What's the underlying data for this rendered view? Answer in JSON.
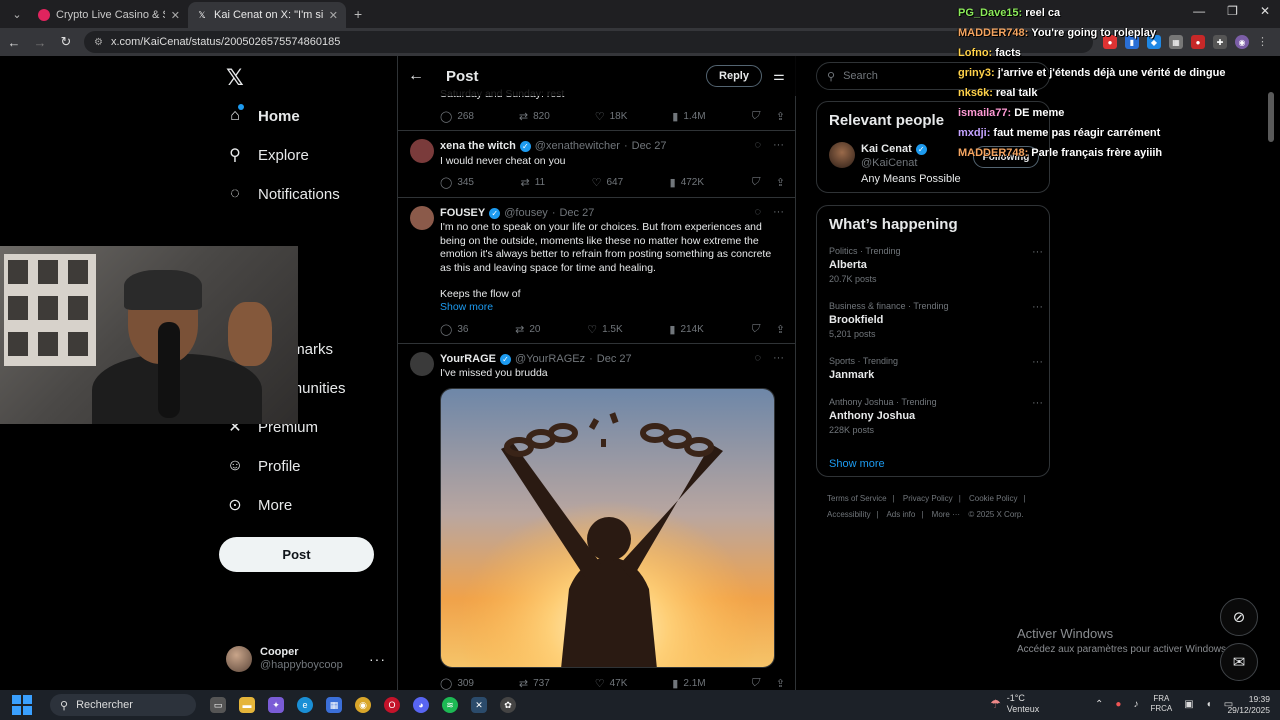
{
  "browser": {
    "tabs": [
      {
        "title": "Crypto Live Casino & Slots | Jo",
        "active": false,
        "icon_color": "#e0245e"
      },
      {
        "title": "Kai Cenat on X: \"I'm single I wil",
        "active": true,
        "icon_color": "#ffffff"
      }
    ],
    "new_tab_glyph": "+",
    "url": "x.com/KaiCenat/status/2005026575574860185"
  },
  "nav": {
    "logo": "𝕏",
    "items": [
      {
        "label": "Home",
        "icon": "home-icon",
        "glyph": "⌂"
      },
      {
        "label": "Explore",
        "icon": "search-icon",
        "glyph": "⚲"
      },
      {
        "label": "Notifications",
        "icon": "bell-icon",
        "glyph": "🔔"
      },
      {
        "label": "Bookmarks",
        "icon": "bookmark-icon",
        "glyph": "⛉"
      },
      {
        "label": "Communities",
        "icon": "communities-icon",
        "glyph": "⚇"
      },
      {
        "label": "Premium",
        "icon": "x-icon",
        "glyph": "✕"
      },
      {
        "label": "Profile",
        "icon": "profile-icon",
        "glyph": "☺"
      },
      {
        "label": "More",
        "icon": "more-circle-icon",
        "glyph": "⊙"
      }
    ],
    "visible_partial": {
      "notifications": "ications",
      "bookmarks": "marks"
    },
    "post_button": "Post",
    "account": {
      "name": "Cooper",
      "handle": "@happyboycoop"
    }
  },
  "post_header": {
    "title": "Post",
    "reply_button": "Reply"
  },
  "tweets": [
    {
      "text": "Saturday and Sunday: rest",
      "replies": "268",
      "reposts": "820",
      "likes": "18K",
      "views": "1.4M"
    },
    {
      "name": "xena the witch",
      "handle": "@xenathewitcher",
      "date": "Dec 27",
      "text": "I would never cheat on you",
      "replies": "345",
      "reposts": "11",
      "likes": "647",
      "views": "472K",
      "avatar_color": "#7a3b3b"
    },
    {
      "name": "FOUSEY",
      "handle": "@fousey",
      "date": "Dec 27",
      "text": "I'm no one to speak on your life or choices. But from experiences and being on the outside, moments like these no matter how extreme the emotion it's always better to refrain from posting something as concrete as this and leaving space for time and healing.",
      "text2": "Keeps the flow of",
      "show_more": "Show more",
      "replies": "36",
      "reposts": "20",
      "likes": "1.5K",
      "views": "214K",
      "avatar_color": "#8b5a4a"
    },
    {
      "name": "YourRAGE",
      "handle": "@YourRAGEz",
      "date": "Dec 27",
      "text": "I've missed you brudda",
      "replies": "309",
      "reposts": "737",
      "likes": "47K",
      "views": "2.1M",
      "avatar_color": "#3a3a3a"
    }
  ],
  "right": {
    "search_placeholder": "Search",
    "relevant_title": "Relevant people",
    "relevant_person": {
      "name": "Kai Cenat",
      "handle": "@KaiCenat",
      "bio": "Any Means Possible",
      "button": "Following"
    },
    "happening_title": "What’s happening",
    "trends": [
      {
        "category": "Politics · Trending",
        "name": "Alberta",
        "count": "20.7K posts"
      },
      {
        "category": "Business & finance · Trending",
        "name": "Brookfield",
        "count": "5,201 posts"
      },
      {
        "category": "Sports · Trending",
        "name": "Janmark",
        "count": ""
      },
      {
        "category": "Anthony Joshua · Trending",
        "name": "Anthony Joshua",
        "count": "228K posts"
      }
    ],
    "show_more": "Show more",
    "footer": {
      "line1": [
        "Terms of Service",
        "|",
        "Privacy Policy",
        "|",
        "Cookie Policy",
        "|"
      ],
      "line2": [
        "Accessibility",
        "|",
        "Ads info",
        "|",
        "More ···",
        "© 2025 X Corp."
      ]
    }
  },
  "chat": [
    {
      "user": "PG_Dave15:",
      "msg": "reel ca",
      "color": "#8bea5a"
    },
    {
      "user": "MADDER748:",
      "msg": "You're going to roleplay",
      "color": "#f4a460"
    },
    {
      "user": "Lofno:",
      "msg": "facts",
      "color": "#ffd24a"
    },
    {
      "user": "griny3:",
      "msg": "j'arrive et j'étends déjà une vérité de dingue",
      "color": "#ffd24a"
    },
    {
      "user": "nks6k:",
      "msg": "real talk",
      "color": "#ffd24a"
    },
    {
      "user": "ismaila77:",
      "msg": "DE meme",
      "color": "#ff9ad5"
    },
    {
      "user": "mxdji:",
      "msg": "faut meme pas réagir carrément",
      "color": "#c4a3ff"
    },
    {
      "user": "MADDER748:",
      "msg": "Parle français frère ayiiih",
      "color": "#f4a460"
    }
  ],
  "activate": {
    "title": "Activer Windows",
    "subtitle": "Accédez aux paramètres pour activer Windows."
  },
  "taskbar": {
    "search": "Rechercher",
    "weather_temp": "-1°C",
    "weather_desc": "Venteux",
    "lang_top": "FRA",
    "lang_bottom": "FRCA",
    "time": "19:39",
    "date": "29/12/2025"
  }
}
